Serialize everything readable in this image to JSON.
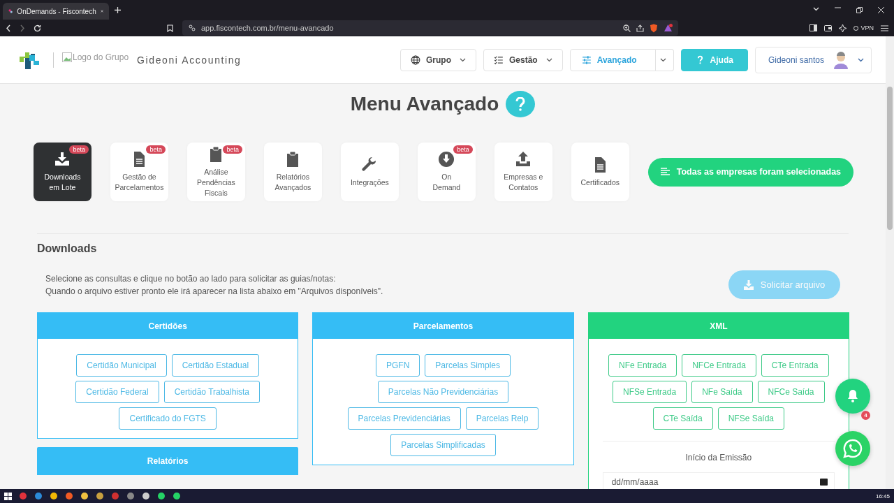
{
  "browser": {
    "tab_title": "OnDemands - Fiscontech",
    "url": "app.fiscontech.com.br/menu-avancado",
    "vpn": "VPN"
  },
  "header": {
    "logo_alt": "Logo do Grupo",
    "company": "Gideoni Accounting",
    "user": "Gideoni santos",
    "nav": [
      {
        "label": "Grupo",
        "kind": "dropdown"
      },
      {
        "label": "Gestão",
        "kind": "dropdown"
      },
      {
        "label": "Avançado",
        "kind": "split"
      },
      {
        "label": "Ajuda",
        "kind": "primary"
      }
    ]
  },
  "title": "Menu Avançado",
  "menu": [
    {
      "lines": [
        "Downloads",
        "em Lote"
      ],
      "badge": "beta",
      "selected": true
    },
    {
      "lines": [
        "Gestão de",
        "Parcelamentos"
      ],
      "badge": "beta",
      "selected": false
    },
    {
      "lines": [
        "Análise",
        "Pendências",
        "Fiscais"
      ],
      "badge": "beta",
      "selected": false
    },
    {
      "lines": [
        "Relatórios",
        "Avançados"
      ],
      "selected": false
    },
    {
      "lines": [
        "Integrações"
      ],
      "selected": false
    },
    {
      "lines": [
        "On",
        "Demand"
      ],
      "badge": "beta",
      "selected": false
    },
    {
      "lines": [
        "Empresas e",
        "Contatos"
      ],
      "selected": false
    },
    {
      "lines": [
        "Certificados"
      ],
      "selected": false
    }
  ],
  "select_all": "Todas as empresas foram selecionadas",
  "section": {
    "title": "Downloads",
    "instructions": [
      "Selecione as consultas e clique no botão ao lado para solicitar as guias/notas:",
      "Quando o arquivo estiver pronto ele irá aparecer na lista abaixo em \"Arquivos disponíveis\"."
    ],
    "request_button": {
      "label": "Solicitar arquivo",
      "disabled": true
    }
  },
  "panels": [
    {
      "title": "Certidões",
      "color": "#35bdf5",
      "rows": [
        [
          "Certidão Municipal",
          "Certidão Estadual"
        ],
        [
          "Certidão Federal",
          "Certidão Trabalhista"
        ],
        [
          "Certificado do FGTS"
        ]
      ]
    },
    {
      "title": "Parcelamentos",
      "color": "#35bdf5",
      "rows": [
        [
          "PGFN",
          "Parcelas Simples"
        ],
        [
          "Parcelas Não Previdenciárias"
        ],
        [
          "Parcelas Previdenciárias",
          "Parcelas Relp"
        ],
        [
          "Parcelas Simplificadas"
        ]
      ]
    },
    {
      "title": "XML",
      "color": "#22d37f",
      "rows": [
        [
          "NFe Entrada",
          "NFCe Entrada",
          "CTe Entrada"
        ],
        [
          "NFSe Entrada",
          "NFe Saída",
          "NFCe Saída"
        ],
        [
          "CTe Saída",
          "NFSe Saída"
        ]
      ],
      "date_label": "Início da Emissão",
      "date_placeholder": "dd/mm/aaaa"
    }
  ],
  "panel_below": {
    "title": "Relatórios",
    "color": "#35bdf5"
  },
  "notifications": {
    "badge": "4"
  },
  "clock": "16:45"
}
